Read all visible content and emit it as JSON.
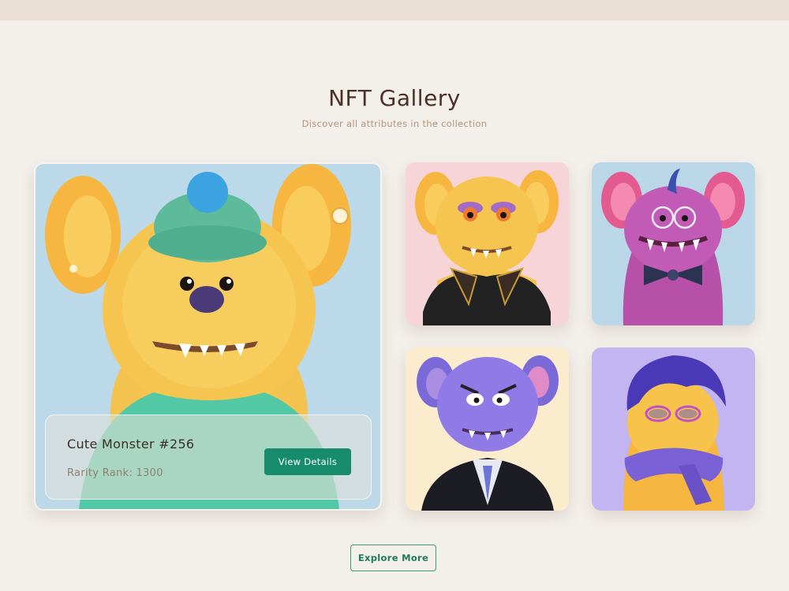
{
  "header": {
    "title": "NFT Gallery",
    "subtitle": "Discover all attributes in the collection"
  },
  "featured": {
    "name": "Cute Monster #256",
    "rarity": "Rarity Rank: 1300",
    "button_label": "View Details"
  },
  "gallery": [
    {
      "background": "#f7d4d8",
      "icon": "yellow-monster-cape-icon"
    },
    {
      "background": "#bad7e8",
      "icon": "pink-monster-bowtie-icon"
    },
    {
      "background": "#fbeccd",
      "icon": "purple-monster-suit-icon"
    },
    {
      "background": "#c3b5f2",
      "icon": "yellow-monster-scarf-icon"
    }
  ],
  "footer": {
    "explore_label": "Explore More"
  },
  "colors": {
    "accent": "#168c6c",
    "title": "#4a3028",
    "subtitle": "#b7937a",
    "page_bg": "#f3efea"
  }
}
